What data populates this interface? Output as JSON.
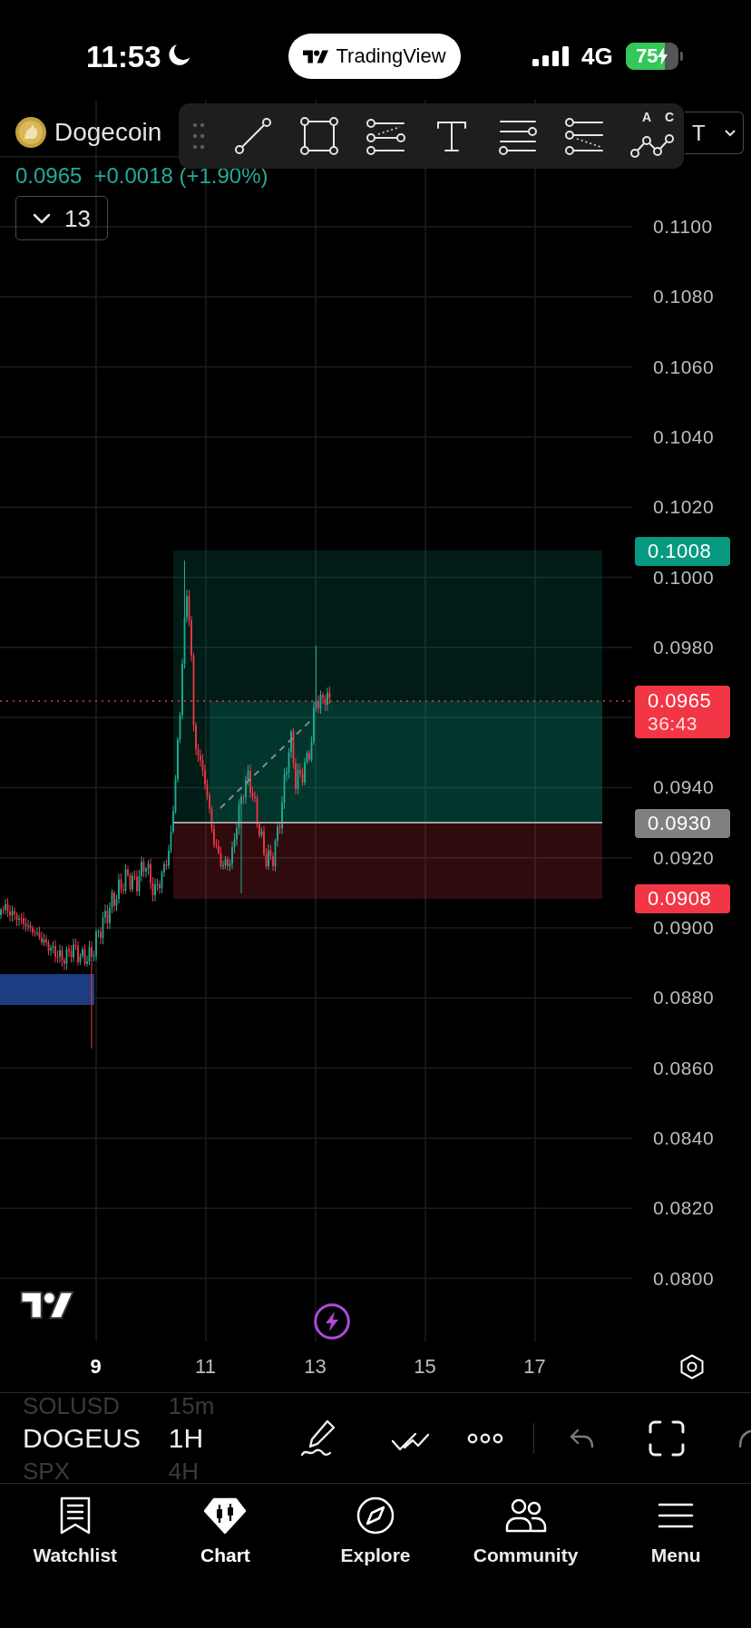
{
  "status_bar": {
    "time": "11:53",
    "focus_mode": true,
    "network": "4G",
    "battery": "75",
    "charging": true
  },
  "app_badge": {
    "label": "TradingView"
  },
  "legend": {
    "symbol": "Dogecoin",
    "price": "0.0965",
    "change": "+0.0018 (+1.90%)",
    "indicators": {
      "count": "13",
      "expanded": false
    }
  },
  "quote_selector": {
    "label": "T"
  },
  "drawing_toolbar": {
    "pattern_labels": [
      "A",
      "C"
    ]
  },
  "price_axis": {
    "ticks": [
      "0.1100",
      "0.1080",
      "0.1060",
      "0.1040",
      "0.1020",
      "0.1000",
      "0.0980",
      "0.0940",
      "0.0920",
      "0.0900",
      "0.0880",
      "0.0860",
      "0.0840",
      "0.0820",
      "0.0800"
    ]
  },
  "price_tags": [
    {
      "kind": "target",
      "price": "0.1008"
    },
    {
      "kind": "current",
      "price": "0.0965",
      "countdown": "36:43"
    },
    {
      "kind": "entry",
      "price": "0.0930"
    },
    {
      "kind": "stop",
      "price": "0.0908"
    }
  ],
  "time_axis": {
    "labels": [
      {
        "label": "9",
        "emphasized": true
      },
      {
        "label": "11",
        "emphasized": false
      },
      {
        "label": "13",
        "emphasized": false
      },
      {
        "label": "15",
        "emphasized": false
      },
      {
        "label": "17",
        "emphasized": false
      }
    ]
  },
  "symbol_picker": [
    {
      "label": "SOLUSD",
      "selected": false
    },
    {
      "label": "DOGEUS",
      "selected": true
    },
    {
      "label": "SPX",
      "selected": false
    }
  ],
  "interval_picker": [
    {
      "label": "15m",
      "selected": false
    },
    {
      "label": "1H",
      "selected": true
    },
    {
      "label": "4H",
      "selected": false
    }
  ],
  "tab_bar": [
    {
      "kind": "watchlist",
      "label": "Watchlist",
      "selected": false
    },
    {
      "kind": "chart",
      "label": "Chart",
      "selected": true
    },
    {
      "kind": "explore",
      "label": "Explore",
      "selected": false
    },
    {
      "kind": "community",
      "label": "Community",
      "selected": false
    },
    {
      "kind": "menu",
      "label": "Menu",
      "selected": false
    }
  ]
}
